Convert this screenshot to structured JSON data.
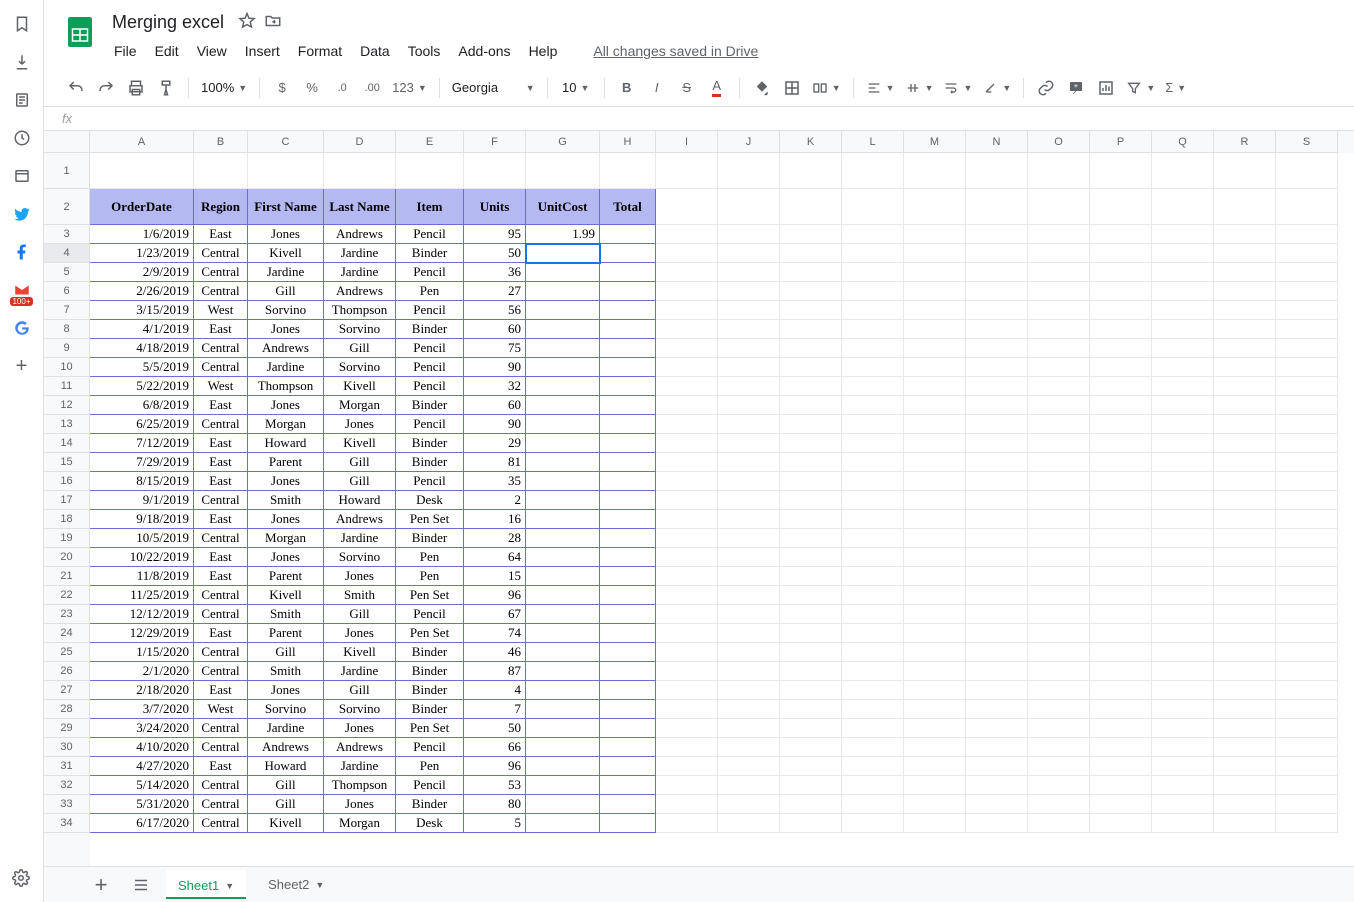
{
  "doc": {
    "title": "Merging excel",
    "saved_status": "All changes saved in Drive"
  },
  "menu": [
    "File",
    "Edit",
    "View",
    "Insert",
    "Format",
    "Data",
    "Tools",
    "Add-ons",
    "Help"
  ],
  "toolbar": {
    "zoom": "100%",
    "font": "Georgia",
    "size": "10",
    "more_fmt": "123"
  },
  "fx": {
    "label": "fx"
  },
  "columns": [
    "A",
    "B",
    "C",
    "D",
    "E",
    "F",
    "G",
    "H",
    "I",
    "J",
    "K",
    "L",
    "M",
    "N",
    "O",
    "P",
    "Q",
    "R",
    "S"
  ],
  "col_widths": {
    "A": 104,
    "B": 54,
    "C": 76,
    "D": 72,
    "E": 68,
    "F": 62,
    "G": 74,
    "H": 56,
    "other": 62
  },
  "row_heights": {
    "r1": 36,
    "r2": 36,
    "data": 19
  },
  "row_numbers": [
    "1",
    "2",
    "3",
    "4",
    "5",
    "6",
    "7",
    "8",
    "9",
    "10",
    "11",
    "12",
    "13",
    "14",
    "15",
    "16",
    "17",
    "18",
    "19",
    "20",
    "21",
    "22",
    "23",
    "24",
    "25",
    "26",
    "27",
    "28",
    "29",
    "30",
    "31",
    "32",
    "33",
    "34"
  ],
  "active_cell": "G4",
  "headers": [
    "OrderDate",
    "Region",
    "First Name",
    "Last Name",
    "Item",
    "Units",
    "UnitCost",
    "Total"
  ],
  "rows": [
    {
      "date": "1/6/2019",
      "region": "East",
      "first": "Jones",
      "last": "Andrews",
      "item": "Pencil",
      "units": "95",
      "cost": "1.99",
      "total": ""
    },
    {
      "date": "1/23/2019",
      "region": "Central",
      "first": "Kivell",
      "last": "Jardine",
      "item": "Binder",
      "units": "50",
      "cost": "",
      "total": ""
    },
    {
      "date": "2/9/2019",
      "region": "Central",
      "first": "Jardine",
      "last": "Jardine",
      "item": "Pencil",
      "units": "36",
      "cost": "",
      "total": ""
    },
    {
      "date": "2/26/2019",
      "region": "Central",
      "first": "Gill",
      "last": "Andrews",
      "item": "Pen",
      "units": "27",
      "cost": "",
      "total": ""
    },
    {
      "date": "3/15/2019",
      "region": "West",
      "first": "Sorvino",
      "last": "Thompson",
      "item": "Pencil",
      "units": "56",
      "cost": "",
      "total": ""
    },
    {
      "date": "4/1/2019",
      "region": "East",
      "first": "Jones",
      "last": "Sorvino",
      "item": "Binder",
      "units": "60",
      "cost": "",
      "total": ""
    },
    {
      "date": "4/18/2019",
      "region": "Central",
      "first": "Andrews",
      "last": "Gill",
      "item": "Pencil",
      "units": "75",
      "cost": "",
      "total": ""
    },
    {
      "date": "5/5/2019",
      "region": "Central",
      "first": "Jardine",
      "last": "Sorvino",
      "item": "Pencil",
      "units": "90",
      "cost": "",
      "total": ""
    },
    {
      "date": "5/22/2019",
      "region": "West",
      "first": "Thompson",
      "last": "Kivell",
      "item": "Pencil",
      "units": "32",
      "cost": "",
      "total": ""
    },
    {
      "date": "6/8/2019",
      "region": "East",
      "first": "Jones",
      "last": "Morgan",
      "item": "Binder",
      "units": "60",
      "cost": "",
      "total": ""
    },
    {
      "date": "6/25/2019",
      "region": "Central",
      "first": "Morgan",
      "last": "Jones",
      "item": "Pencil",
      "units": "90",
      "cost": "",
      "total": ""
    },
    {
      "date": "7/12/2019",
      "region": "East",
      "first": "Howard",
      "last": "Kivell",
      "item": "Binder",
      "units": "29",
      "cost": "",
      "total": ""
    },
    {
      "date": "7/29/2019",
      "region": "East",
      "first": "Parent",
      "last": "Gill",
      "item": "Binder",
      "units": "81",
      "cost": "",
      "total": ""
    },
    {
      "date": "8/15/2019",
      "region": "East",
      "first": "Jones",
      "last": "Gill",
      "item": "Pencil",
      "units": "35",
      "cost": "",
      "total": ""
    },
    {
      "date": "9/1/2019",
      "region": "Central",
      "first": "Smith",
      "last": "Howard",
      "item": "Desk",
      "units": "2",
      "cost": "",
      "total": ""
    },
    {
      "date": "9/18/2019",
      "region": "East",
      "first": "Jones",
      "last": "Andrews",
      "item": "Pen Set",
      "units": "16",
      "cost": "",
      "total": ""
    },
    {
      "date": "10/5/2019",
      "region": "Central",
      "first": "Morgan",
      "last": "Jardine",
      "item": "Binder",
      "units": "28",
      "cost": "",
      "total": ""
    },
    {
      "date": "10/22/2019",
      "region": "East",
      "first": "Jones",
      "last": "Sorvino",
      "item": "Pen",
      "units": "64",
      "cost": "",
      "total": ""
    },
    {
      "date": "11/8/2019",
      "region": "East",
      "first": "Parent",
      "last": "Jones",
      "item": "Pen",
      "units": "15",
      "cost": "",
      "total": ""
    },
    {
      "date": "11/25/2019",
      "region": "Central",
      "first": "Kivell",
      "last": "Smith",
      "item": "Pen Set",
      "units": "96",
      "cost": "",
      "total": ""
    },
    {
      "date": "12/12/2019",
      "region": "Central",
      "first": "Smith",
      "last": "Gill",
      "item": "Pencil",
      "units": "67",
      "cost": "",
      "total": ""
    },
    {
      "date": "12/29/2019",
      "region": "East",
      "first": "Parent",
      "last": "Jones",
      "item": "Pen Set",
      "units": "74",
      "cost": "",
      "total": ""
    },
    {
      "date": "1/15/2020",
      "region": "Central",
      "first": "Gill",
      "last": "Kivell",
      "item": "Binder",
      "units": "46",
      "cost": "",
      "total": ""
    },
    {
      "date": "2/1/2020",
      "region": "Central",
      "first": "Smith",
      "last": "Jardine",
      "item": "Binder",
      "units": "87",
      "cost": "",
      "total": ""
    },
    {
      "date": "2/18/2020",
      "region": "East",
      "first": "Jones",
      "last": "Gill",
      "item": "Binder",
      "units": "4",
      "cost": "",
      "total": ""
    },
    {
      "date": "3/7/2020",
      "region": "West",
      "first": "Sorvino",
      "last": "Sorvino",
      "item": "Binder",
      "units": "7",
      "cost": "",
      "total": ""
    },
    {
      "date": "3/24/2020",
      "region": "Central",
      "first": "Jardine",
      "last": "Jones",
      "item": "Pen Set",
      "units": "50",
      "cost": "",
      "total": ""
    },
    {
      "date": "4/10/2020",
      "region": "Central",
      "first": "Andrews",
      "last": "Andrews",
      "item": "Pencil",
      "units": "66",
      "cost": "",
      "total": ""
    },
    {
      "date": "4/27/2020",
      "region": "East",
      "first": "Howard",
      "last": "Jardine",
      "item": "Pen",
      "units": "96",
      "cost": "",
      "total": ""
    },
    {
      "date": "5/14/2020",
      "region": "Central",
      "first": "Gill",
      "last": "Thompson",
      "item": "Pencil",
      "units": "53",
      "cost": "",
      "total": ""
    },
    {
      "date": "5/31/2020",
      "region": "Central",
      "first": "Gill",
      "last": "Jones",
      "item": "Binder",
      "units": "80",
      "cost": "",
      "total": ""
    },
    {
      "date": "6/17/2020",
      "region": "Central",
      "first": "Kivell",
      "last": "Morgan",
      "item": "Desk",
      "units": "5",
      "cost": "",
      "total": ""
    }
  ],
  "tabs": [
    {
      "name": "Sheet1",
      "active": true
    },
    {
      "name": "Sheet2",
      "active": false
    }
  ],
  "gmail_badge": "100+"
}
